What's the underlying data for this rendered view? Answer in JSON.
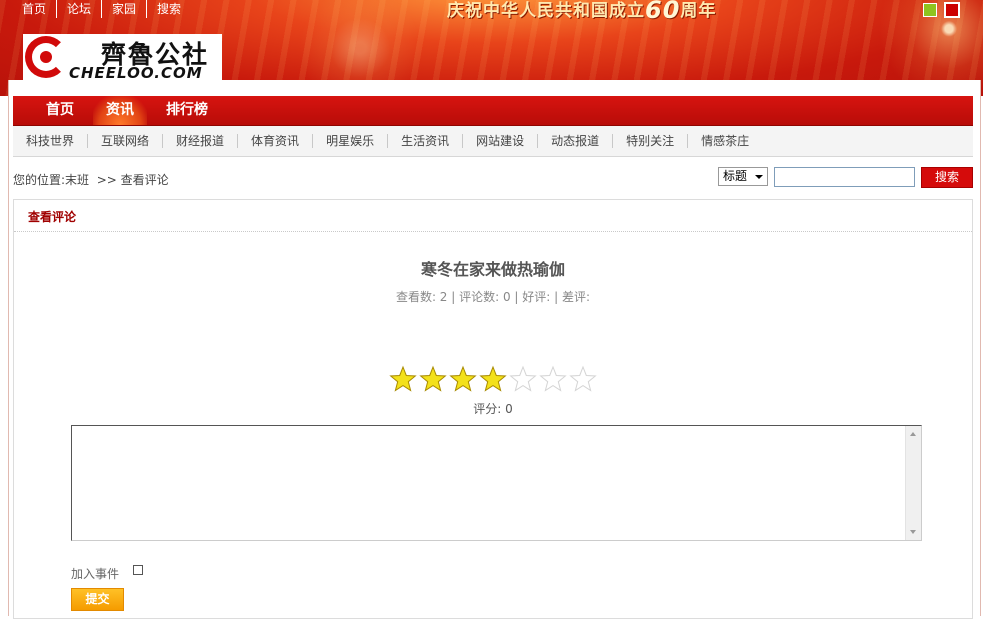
{
  "top_links": [
    "首页",
    "论坛",
    "家园",
    "搜索"
  ],
  "celebration": {
    "text_before": "庆祝中华人民共和国成立",
    "number": "60",
    "text_after": "周年"
  },
  "logo": {
    "cn": "齊魯公社",
    "en": "CHEELOO.COM"
  },
  "main_nav": [
    {
      "label": "首页",
      "active": false
    },
    {
      "label": "资讯",
      "active": true
    },
    {
      "label": "排行榜",
      "active": false
    }
  ],
  "sub_nav": [
    "科技世界",
    "互联网络",
    "财经报道",
    "体育资讯",
    "明星娱乐",
    "生活资讯",
    "网站建设",
    "动态报道",
    "特别关注",
    "情感茶庄"
  ],
  "location": {
    "prefix": "您的位置:",
    "site": "末班",
    "sep": ">>",
    "current": "查看评论"
  },
  "search": {
    "field": "标题",
    "value": "",
    "button": "搜索"
  },
  "panel": {
    "title": "查看评论",
    "article_title": "寒冬在家来做热瑜伽",
    "stats": "查看数: 2 | 评论数: 0 | 好评: | 差评:",
    "rating": {
      "filled": 4,
      "total": 7
    },
    "score": "评分: 0",
    "comment_value": "",
    "add_event_label": "加入事件",
    "add_event_checked": false,
    "submit_label": "提交"
  },
  "colors": {
    "brand_red": "#d50b0b",
    "submit_orange": "#f5a000",
    "star_fill": "#f3e11b"
  }
}
